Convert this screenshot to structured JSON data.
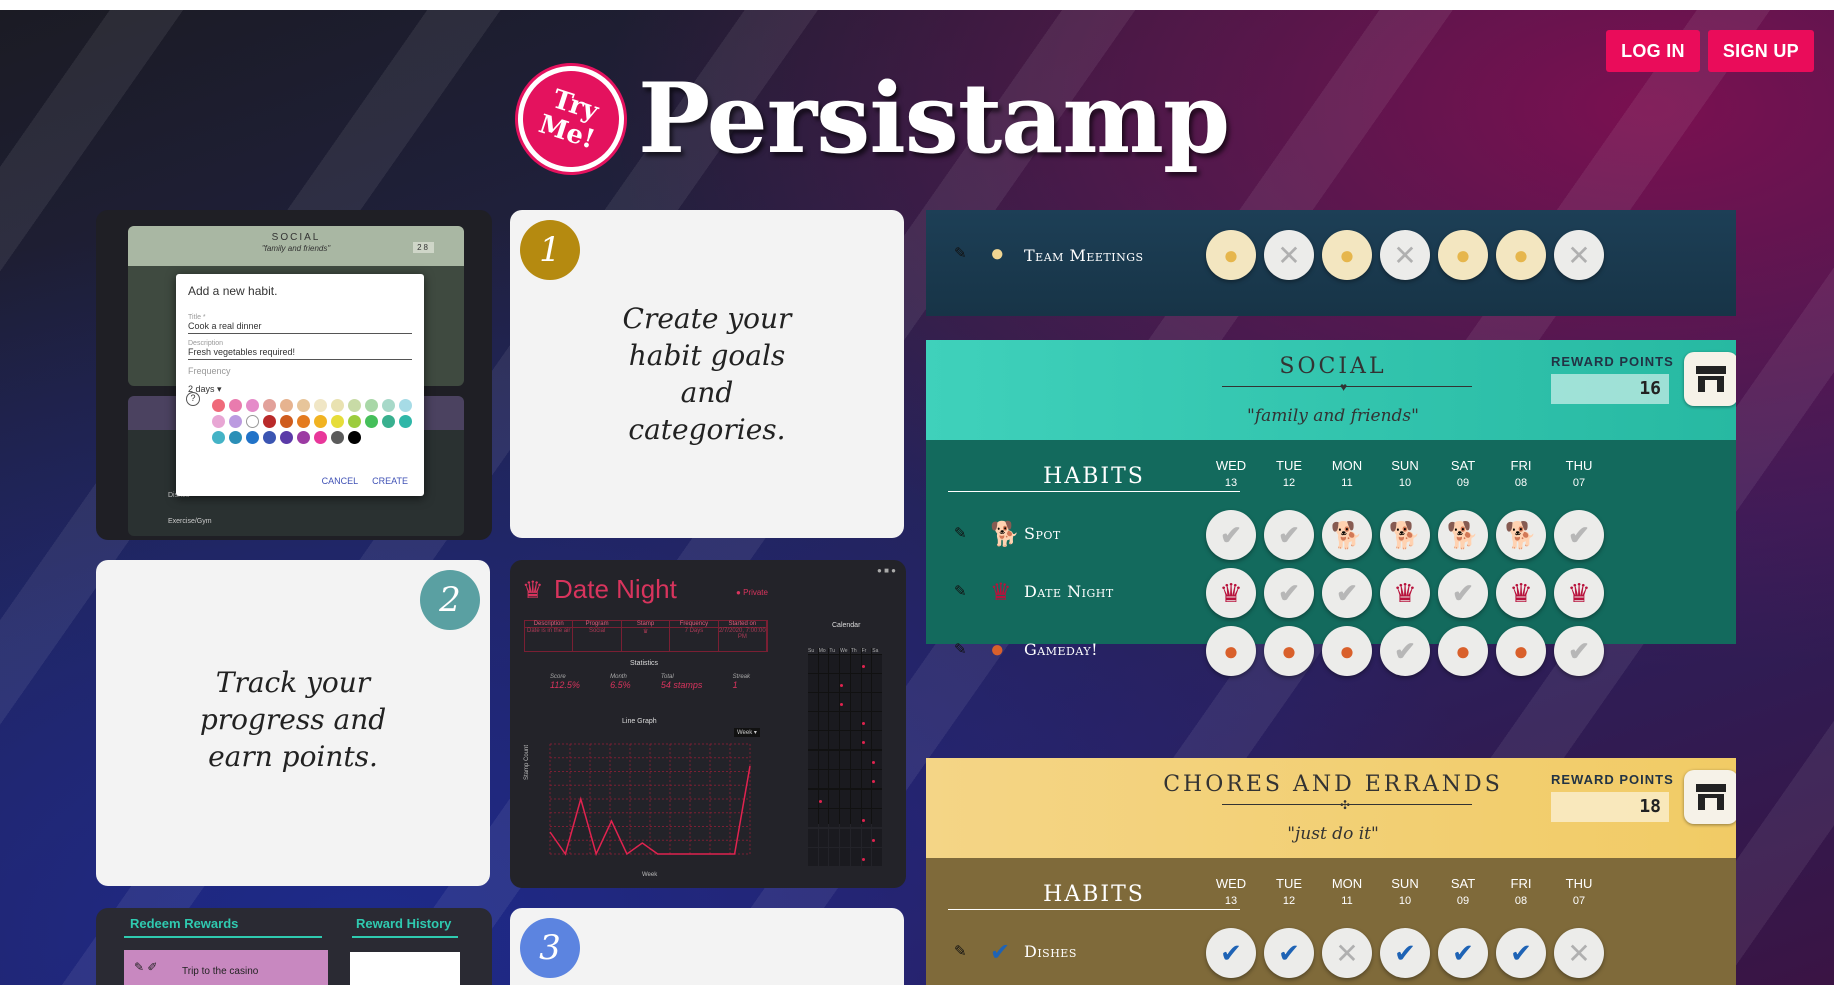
{
  "auth": {
    "login": "LOG IN",
    "signup": "SIGN UP"
  },
  "brand": {
    "badge_line1": "Try",
    "badge_line2": "Me!",
    "name": "Persistamp"
  },
  "steps": [
    {
      "num": "1",
      "text_lines": [
        "Create your",
        "habit goals",
        "and",
        "categories."
      ],
      "color": "#b58a10"
    },
    {
      "num": "2",
      "text_lines": [
        "Track your",
        "progress and",
        "earn points."
      ],
      "color": "#5aa0a2"
    },
    {
      "num": "3",
      "text_lines": [],
      "color": "#5c84e0"
    }
  ],
  "preview_new_habit": {
    "header_label": "SOCIAL",
    "header_sub": "\"family and friends\"",
    "points": "28",
    "dialog_title": "Add a new habit.",
    "title_label": "Title *",
    "title_value": "Cook a real dinner",
    "desc_label": "Description",
    "desc_value": "Fresh vegetables required!",
    "freq_label": "Frequency",
    "freq_value": "2 days",
    "cancel": "CANCEL",
    "create": "CREATE",
    "row1": "Dishes",
    "row2": "Exercise/Gym",
    "swatch_colors": [
      "#ef6a7a",
      "#e97bae",
      "#e58bc9",
      "#e2a19a",
      "#e6b38f",
      "#e7c59a",
      "#f0e6c5",
      "#e9e2b1",
      "#c8dba6",
      "#a8d7a7",
      "#a7d9c9",
      "#a6dbe6",
      "#e8a6d4",
      "#bb9ae0",
      "#ffffff",
      "#b92a2a",
      "#cf5c1d",
      "#e47b1f",
      "#f1b322",
      "#e6dd3a",
      "#9ccc3d",
      "#45bf5a",
      "#39b08f",
      "#2fb7a8",
      "#44b3c6",
      "#2b8fb7",
      "#2173c8",
      "#3b55b2",
      "#5b3aa8",
      "#9c3ba3",
      "#e8379a",
      "#5b5b5b",
      "#000000"
    ]
  },
  "preview_date_night": {
    "title": "Date Night",
    "toggle": "Private",
    "table_headers": [
      "Description",
      "Program",
      "Stamp",
      "Frequency",
      "Started on"
    ],
    "table_values": [
      "Date is in the air",
      "Social",
      "",
      "7 Days",
      "2/7/2020, 7:00:00 PM"
    ],
    "stats_title": "Statistics",
    "stat_labels": [
      "Score",
      "Month",
      "Total",
      "Streak"
    ],
    "stat_values": [
      "112.5%",
      "6.5%",
      "54 stamps",
      "1"
    ],
    "line_title": "Line Graph",
    "line_select": "Week",
    "y_axis": "Stamp Count",
    "x_axis": "Week",
    "calendar_title": "Calendar",
    "calendar_days": [
      "Su",
      "Mo",
      "Tu",
      "We",
      "Th",
      "Fr",
      "Sa"
    ],
    "line_values": [
      0.2,
      0.0,
      0.5,
      0.0,
      0.3,
      0.0,
      0.1,
      0.0,
      0.0,
      0.0,
      0.0,
      0.0,
      0.0,
      0.8
    ]
  },
  "preview_rewards": {
    "redeem": "Redeem Rewards",
    "history": "Reward History",
    "item": "Trip to the casino"
  },
  "team": {
    "name": "Team Meetings",
    "stamps": [
      "gold",
      "x",
      "gold",
      "x",
      "gold",
      "gold",
      "x"
    ]
  },
  "days": [
    {
      "name": "WED",
      "num": "13"
    },
    {
      "name": "TUE",
      "num": "12"
    },
    {
      "name": "MON",
      "num": "11"
    },
    {
      "name": "SUN",
      "num": "10"
    },
    {
      "name": "SAT",
      "num": "09"
    },
    {
      "name": "FRI",
      "num": "08"
    },
    {
      "name": "THU",
      "num": "07"
    }
  ],
  "social": {
    "title": "SOCIAL",
    "subtitle": "\"family and friends\"",
    "reward_label": "REWARD POINTS",
    "points": "16",
    "habits_label": "HABITS",
    "habits": [
      {
        "name": "Spot",
        "icon": "dog-icon",
        "glyph": "🐕",
        "stamps": [
          "check",
          "check",
          "pink",
          "pink",
          "pink",
          "pink",
          "check"
        ]
      },
      {
        "name": "Date Night",
        "icon": "crown-icon",
        "glyph": "♛",
        "stamps": [
          "red",
          "check",
          "check",
          "red",
          "check",
          "red",
          "red"
        ]
      },
      {
        "name": "Gameday!",
        "icon": "basketball-icon",
        "glyph": "●",
        "stamps": [
          "orange",
          "orange",
          "orange",
          "check",
          "orange",
          "orange",
          "check"
        ]
      }
    ]
  },
  "chores": {
    "title": "CHORES AND ERRANDS",
    "subtitle": "\"just do it\"",
    "reward_label": "REWARD POINTS",
    "points": "18",
    "habits_label": "HABITS",
    "habits": [
      {
        "name": "Dishes",
        "icon": "checkmark-circle-icon",
        "glyph": "✔",
        "stamps": [
          "blue",
          "blue",
          "x",
          "blue",
          "blue",
          "blue",
          "x"
        ]
      }
    ]
  },
  "colors": {
    "accent": "#ea0c5a",
    "social": "#2bbca5",
    "social_dark": "#136a5d",
    "chores": "#f2cd6b",
    "chores_dark": "#7f6a3a"
  }
}
